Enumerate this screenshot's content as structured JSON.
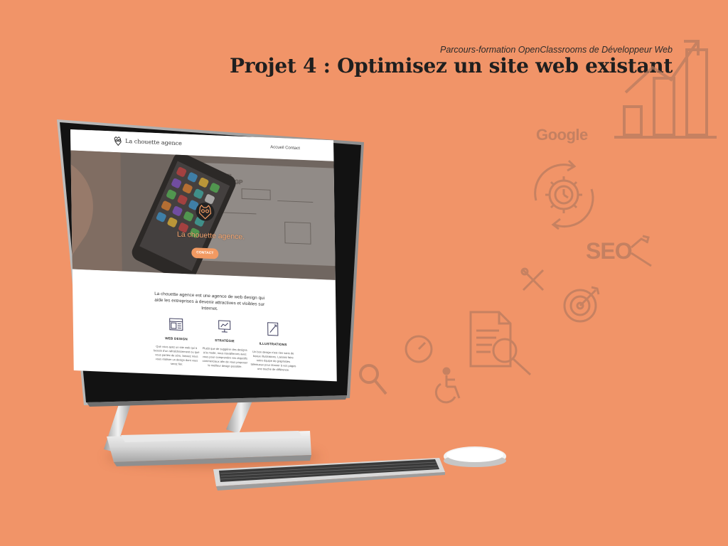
{
  "header": {
    "subtitle": "Parcours-formation OpenClassrooms de Développeur Web",
    "title": "Projet 4 : Optimisez un site web existant"
  },
  "decor": {
    "google_text": "Google",
    "seo_text": "SEO",
    "icons": [
      "bar-chart-icon",
      "gear-refresh-icon",
      "magnifier-icon",
      "tools-icon",
      "target-icon",
      "document-search-icon",
      "speedometer-icon",
      "accessibility-icon"
    ]
  },
  "website": {
    "logo_text": "La chouette agence",
    "nav": {
      "home": "Accueil",
      "contact": "Contact"
    },
    "hero": {
      "title": "La chouette agence.",
      "button": "CONTACT"
    },
    "intro": "La chouette agence est une agence de web design qui aide les entreprises à devenir attractives et visibles sur Internet.",
    "services": [
      {
        "icon": "web-design-icon",
        "title": "WEB DESIGN",
        "text": "Que vous ayez un site web qui a besoin d'un rafraîchissement ou que vous partiez de zéro, laissez nous vous réaliser un design dont vous serez fier."
      },
      {
        "icon": "strategy-icon",
        "title": "STRATÉGIE",
        "text": "Plutôt que de suggérer des designs à la mode, nous travaillerons avec vous pour comprendre vos objectifs commerciaux afin de vous proposer le meilleur design possible."
      },
      {
        "icon": "illustration-icon",
        "title": "ILLUSTRATIONS",
        "text": "Un bon design n'est rien sans de beaux illustrations. Laissez faire notre équipe de graphistes talentueux pour donner à vos pages une touche de différence."
      }
    ]
  },
  "colors": {
    "background": "#F19468",
    "accent": "#F29A62",
    "icon_tint": "#B57A5F"
  }
}
